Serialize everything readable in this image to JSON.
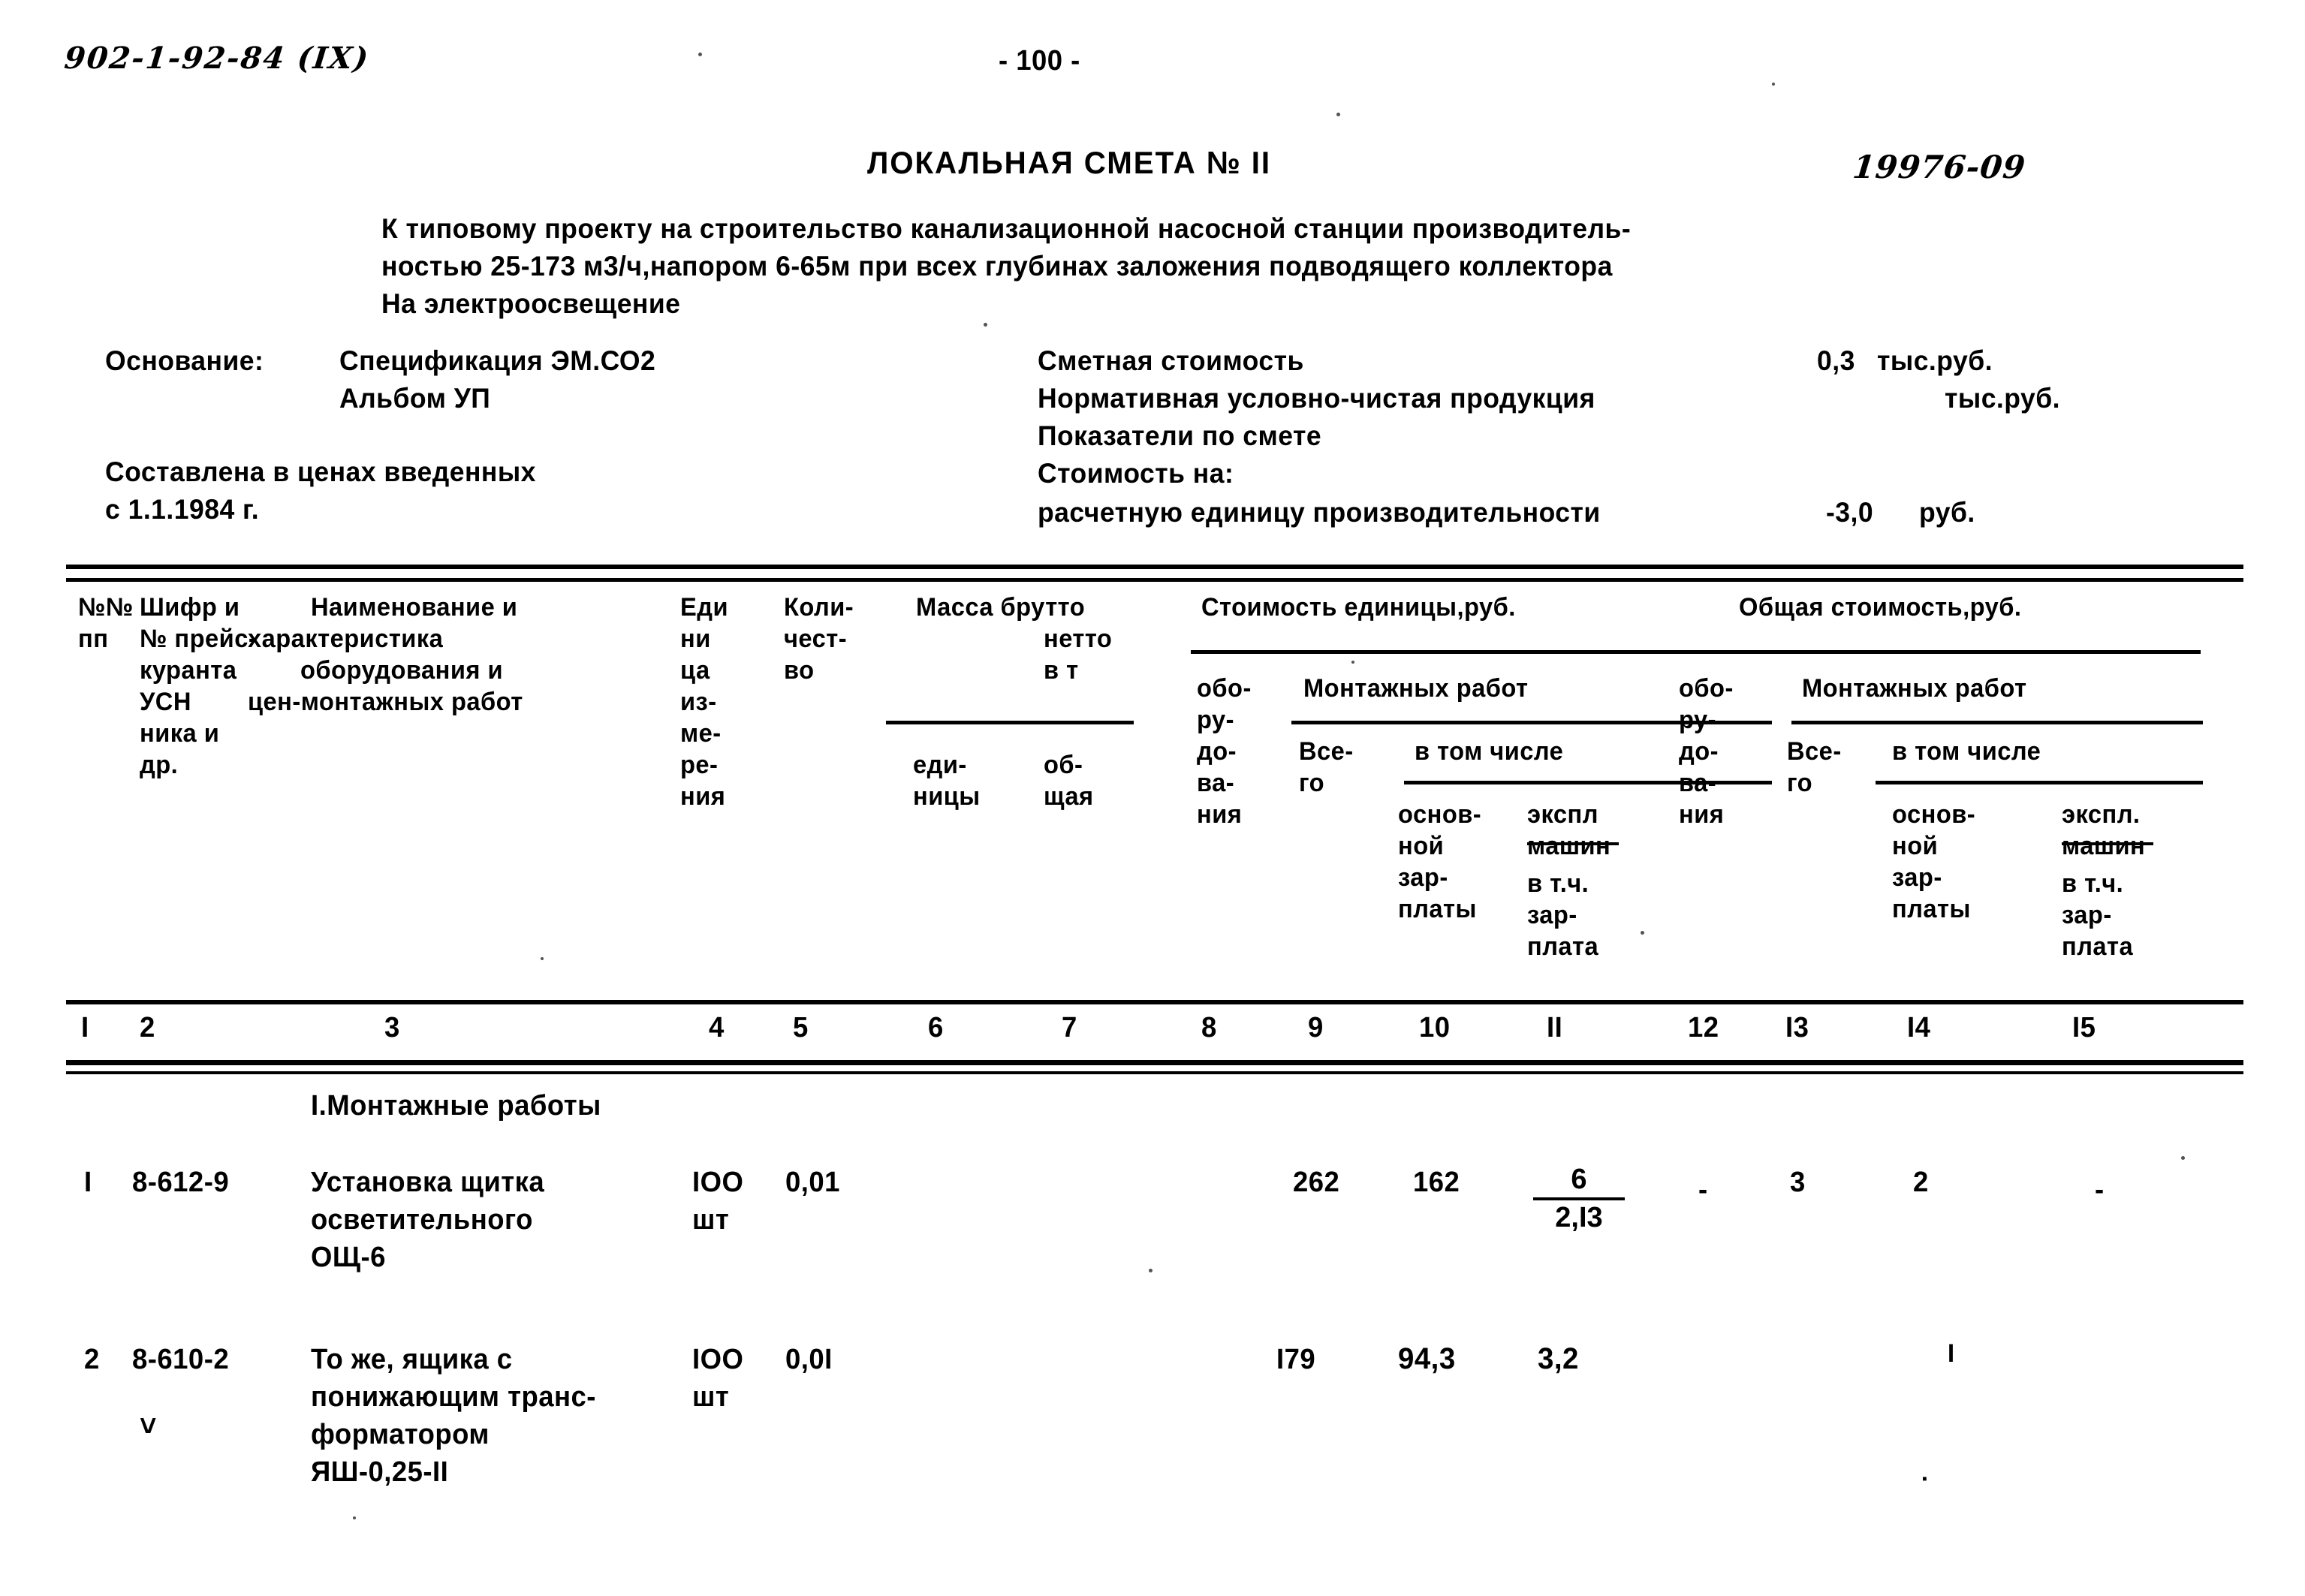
{
  "document": {
    "series_code": "902-1-92-84 (IX)",
    "page_marker": "- 100 -",
    "title": "ЛОКАЛЬНАЯ СМЕТА № II",
    "stamp_number": "19976-09",
    "subtitle_line1": "К типовому проекту на строительство канализационной насосной станции производитель-",
    "subtitle_line2": "ностью 25-173 м3/ч,напором 6-65м при всех глубинах заложения подводящего коллектора",
    "subtitle_line3": "На электроосвещение"
  },
  "basis": {
    "label": "Основание:",
    "value_line1": "Спецификация ЭМ.СО2",
    "value_line2": "Альбом УП",
    "prices_line1": "Составлена в ценах введенных",
    "prices_line2": "с 1.1.1984 г."
  },
  "summary": {
    "rows": [
      {
        "label": "Сметная стоимость",
        "value": "0,3",
        "unit": "тыс.руб."
      },
      {
        "label": "Нормативная условно-чистая продукция",
        "value": "",
        "unit": "тыс.руб."
      },
      {
        "label": "Показатели по смете",
        "value": "",
        "unit": ""
      },
      {
        "label": "Стоимость на:",
        "value": "",
        "unit": ""
      },
      {
        "label": "расчетную единицу производительности",
        "value": "-3,0",
        "unit": "руб."
      }
    ]
  },
  "table": {
    "header": {
      "col1": [
        "№№",
        "пп"
      ],
      "col2": [
        "Шифр и",
        "№ прейс-",
        "куранта",
        "УСН",
        "ника и",
        "др."
      ],
      "col3": [
        "Наименование и",
        "характеристика",
        "оборудования и",
        "цен-монтажных работ"
      ],
      "col4": [
        "Еди",
        "ни",
        "ца",
        "из-",
        "ме-",
        "ре-",
        "ния"
      ],
      "col5": [
        "Коли-",
        "чест-",
        "во"
      ],
      "mass_group": "Масса брутто",
      "mass_sub": [
        "нетто",
        "в т"
      ],
      "col6": [
        "еди-",
        "ницы"
      ],
      "col7": [
        "об-",
        "щая"
      ],
      "unit_cost_group": "Стоимость единицы,руб.",
      "col8": [
        "обо-",
        "ру-",
        "до-",
        "ва-",
        "ния"
      ],
      "mont_group_left": "Монтажных работ",
      "col9": [
        "Все-",
        "го"
      ],
      "in_that_number_left": "в том числе",
      "col10": [
        "основ-",
        "ной",
        "зар-",
        "платы"
      ],
      "col11": [
        "экспл",
        "машин",
        "в т.ч.",
        "зар-",
        "плата"
      ],
      "total_cost_group": "Общая стоимость,руб.",
      "col12": [
        "обо-",
        "ру-",
        "до-",
        "ва-",
        "ния"
      ],
      "mont_group_right": "Монтажных работ",
      "col13": [
        "Все-",
        "го"
      ],
      "in_that_number_right": "в том числе",
      "col14": [
        "основ-",
        "ной",
        "зар-",
        "платы"
      ],
      "col15": [
        "экспл.",
        "машин",
        "в т.ч.",
        "зар-",
        "плата"
      ]
    },
    "column_numbers": [
      "I",
      "2",
      "3",
      "4",
      "5",
      "6",
      "7",
      "8",
      "9",
      "10",
      "II",
      "12",
      "I3",
      "I4",
      "I5"
    ],
    "section_title": "I.Монтажные работы",
    "rows": [
      {
        "no": "I",
        "code": "8-612-9",
        "name_lines": [
          "Установка щитка",
          "осветительного",
          "ОЩ-6"
        ],
        "unit_lines": [
          "IOO",
          "шт"
        ],
        "qty": "0,01",
        "mass_unit": "",
        "mass_total": "",
        "equip_unit": "",
        "mont_total_unit": "262",
        "mont_base_unit": "162",
        "mach_unit_num": "6",
        "mach_unit_den": "2,I3",
        "equip_total": "-",
        "mont_total": "3",
        "mont_base_total": "2",
        "mach_total": "-"
      },
      {
        "no": "2",
        "code": "8-610-2",
        "name_lines": [
          "То же, ящика с",
          "понижающим транс-",
          "форматором",
          "ЯШ-0,25-II"
        ],
        "unit_lines": [
          "IOO",
          "шт"
        ],
        "qty": "0,0I",
        "mass_unit": "",
        "mass_total": "",
        "equip_unit": "",
        "mont_total_unit": "I79",
        "mont_base_unit": "94,3",
        "mach_unit_num": "3,2",
        "mach_unit_den": "",
        "equip_total": "",
        "mont_total": "",
        "mont_base_total": "I",
        "mach_total": ""
      }
    ]
  }
}
